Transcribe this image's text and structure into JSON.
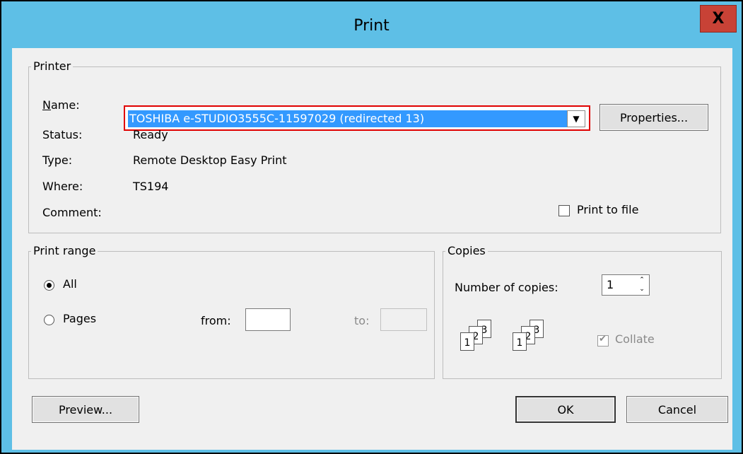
{
  "window": {
    "title": "Print",
    "close_label": "X"
  },
  "printer_group": {
    "legend": "Printer",
    "name_label": "Name:",
    "name_value": "TOSHIBA e-STUDIO3555C-11597029 (redirected 13)",
    "properties_label": "Properties...",
    "status_label": "Status:",
    "status_value": "Ready",
    "type_label": "Type:",
    "type_value": "Remote Desktop Easy Print",
    "where_label": "Where:",
    "where_value": "TS194",
    "comment_label": "Comment:",
    "comment_value": "",
    "print_to_file_label": "Print to file",
    "print_to_file_checked": false
  },
  "print_range": {
    "legend": "Print range",
    "all_label": "All",
    "pages_label": "Pages",
    "from_label": "from:",
    "from_value": "",
    "to_label": "to:",
    "to_value": "",
    "selected": "All"
  },
  "copies": {
    "legend": "Copies",
    "number_label": "Number of copies:",
    "number_value": "1",
    "collate_label": "Collate",
    "collate_checked": true,
    "page_numbers": [
      "1",
      "2",
      "3"
    ]
  },
  "footer": {
    "preview_label": "Preview...",
    "ok_label": "OK",
    "cancel_label": "Cancel"
  },
  "colors": {
    "title_bar": "#5ebfe6",
    "close_button": "#c84236",
    "selection": "#3399ff",
    "highlight_border": "#e00000"
  }
}
